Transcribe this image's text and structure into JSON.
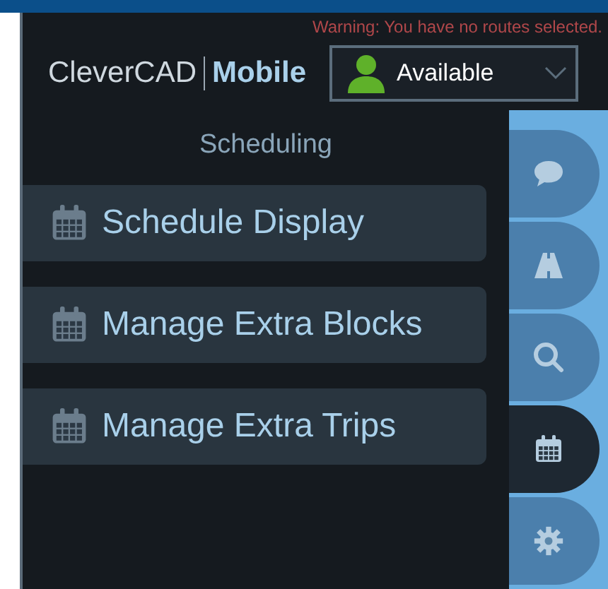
{
  "warning": "Warning: You have no routes selected.",
  "logo": {
    "name": "CleverCAD",
    "product": "Mobile"
  },
  "status": {
    "value": "Available"
  },
  "menu": {
    "title": "Scheduling",
    "items": [
      {
        "label": "Schedule Display"
      },
      {
        "label": "Manage Extra Blocks"
      },
      {
        "label": "Manage Extra Trips"
      }
    ]
  },
  "rail": [
    {
      "kind": "chat",
      "selected": false
    },
    {
      "kind": "road",
      "selected": false
    },
    {
      "kind": "search",
      "selected": false
    },
    {
      "kind": "calendar",
      "selected": true
    },
    {
      "kind": "settings",
      "selected": false
    }
  ]
}
